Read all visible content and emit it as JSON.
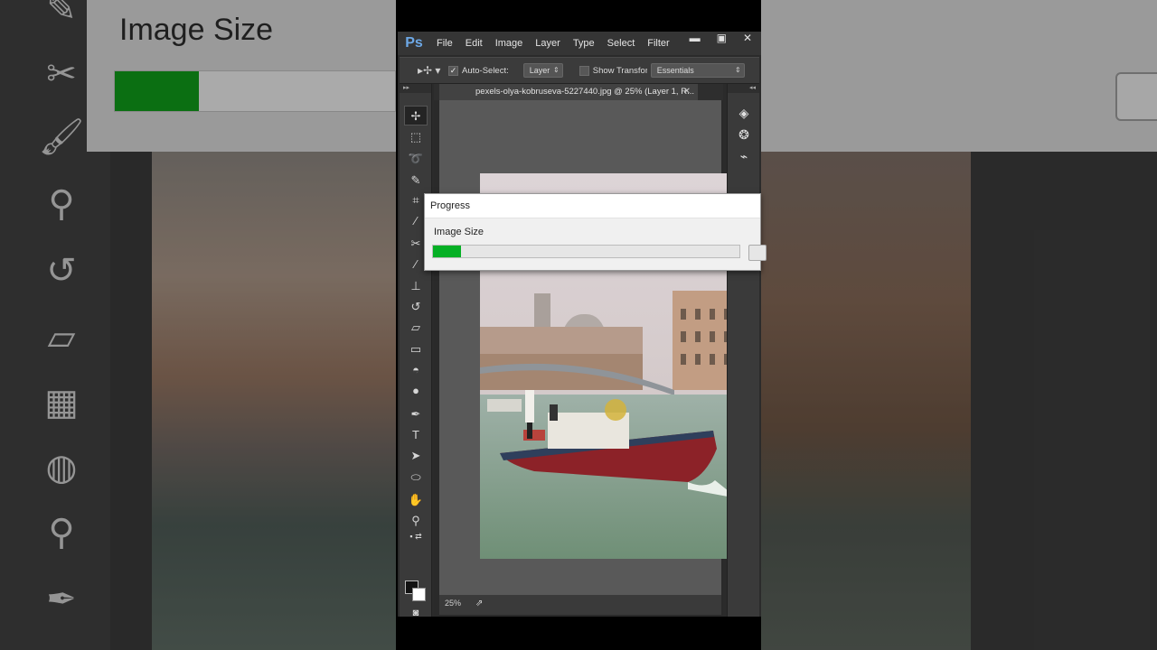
{
  "app": {
    "logo": "Ps",
    "menu": [
      "File",
      "Edit",
      "Image",
      "Layer",
      "Type",
      "Select",
      "Filter"
    ],
    "window_controls": [
      "minimize-icon",
      "maximize-icon",
      "close-icon"
    ]
  },
  "options_bar": {
    "tool_icon": "move-tool-icon",
    "auto_select_label": "Auto-Select:",
    "auto_select_checked": true,
    "auto_select_target": "Layer",
    "show_transform_label": "Show Transform Controls",
    "show_transform_checked": false,
    "workspace": "Essentials"
  },
  "document": {
    "tab_title": "pexels-olya-kobruseva-5227440.jpg @ 25% (Layer 1, R...",
    "zoom": "25%"
  },
  "tools": [
    "move-tool-icon",
    "rectangular-marquee-icon",
    "lasso-icon",
    "quick-selection-icon",
    "crop-icon",
    "eyedropper-icon",
    "spot-healing-icon",
    "brush-icon",
    "clone-stamp-icon",
    "history-brush-icon",
    "eraser-icon",
    "gradient-icon",
    "blur-icon",
    "dodge-icon",
    "pen-icon",
    "type-icon",
    "path-selection-icon",
    "ellipse-icon",
    "hand-icon",
    "zoom-icon",
    "quick-mask-icon",
    "screen-mode-icon"
  ],
  "right_panel": [
    "layers-icon",
    "channels-icon",
    "paths-icon"
  ],
  "progress_dialog": {
    "title": "Progress",
    "label": "Image Size",
    "progress": 0.09,
    "fill_color": "#06b025"
  },
  "background_copy": {
    "dialog_label": "Image Size",
    "progress": 0.3
  }
}
